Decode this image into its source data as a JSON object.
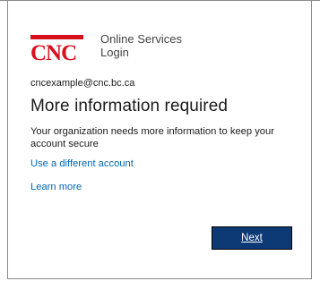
{
  "brand": {
    "logo_text": "CNC",
    "service_line1": "Online Services",
    "service_line2": "Login",
    "accent_color": "#d8101e"
  },
  "account": {
    "email": "cncexample@cnc.bc.ca"
  },
  "main": {
    "title": "More information required",
    "description": "Your organization needs more information to keep your account secure",
    "different_account_link": "Use a different account",
    "learn_more_link": "Learn more",
    "next_button": "Next",
    "link_color": "#0067b8",
    "button_color": "#0d3a75"
  }
}
